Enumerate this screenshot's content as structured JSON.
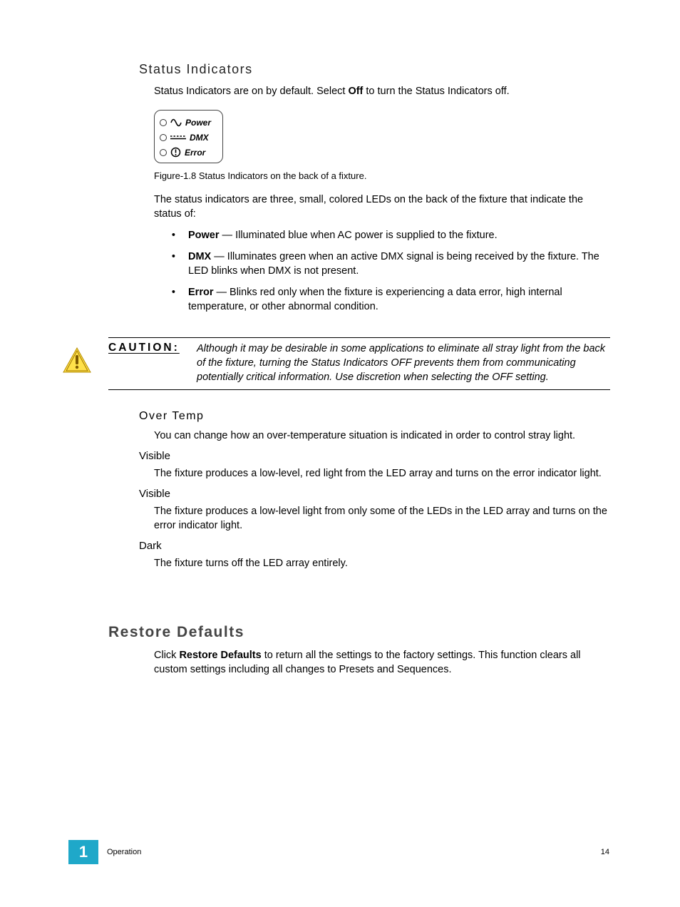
{
  "statusIndicators": {
    "heading": "Status Indicators",
    "intro_pre": "Status Indicators are on by default. Select ",
    "intro_bold": "Off",
    "intro_post": " to turn the Status Indicators off.",
    "fig": {
      "power": "Power",
      "dmx": "DMX",
      "error": "Error"
    },
    "caption": "Figure-1.8 Status Indicators on the back of a fixture.",
    "desc": "The status indicators are three, small, colored LEDs on the back of the fixture that indicate the status of:",
    "items": [
      {
        "term": "Power",
        "text": " — Illuminated blue when AC power is supplied to the fixture."
      },
      {
        "term": "DMX",
        "text": " — Illuminates green when an active DMX signal is being received by the fixture. The LED blinks when DMX is not present."
      },
      {
        "term": "Error",
        "text": " — Blinks red only when the fixture is experiencing a data error, high internal temperature, or other abnormal condition."
      }
    ]
  },
  "caution": {
    "label": "CAUTION:",
    "text": "Although it may be desirable in some applications to eliminate all stray light from the back of the fixture, turning the Status Indicators OFF prevents them from communicating potentially critical information. Use discretion when selecting the OFF setting."
  },
  "overTemp": {
    "heading": "Over Temp",
    "intro": "You can change how an over-temperature situation is indicated in order to control stray light.",
    "sections": [
      {
        "title": "Visible",
        "body": "The fixture produces a low-level, red light from the LED array and turns on the error indicator light."
      },
      {
        "title": "Visible",
        "body": "The fixture produces a low-level light from only some of the LEDs in the LED array and turns on the error indicator light."
      },
      {
        "title": "Dark",
        "body": "The fixture turns off the LED array entirely."
      }
    ]
  },
  "restore": {
    "heading": "Restore Defaults",
    "body_pre": "Click ",
    "body_bold": "Restore Defaults",
    "body_post": " to return all the settings to the factory settings. This function clears all custom settings including all changes to Presets and Sequences."
  },
  "footer": {
    "chapter_num": "1",
    "chapter_name": "Operation",
    "page": "14"
  }
}
